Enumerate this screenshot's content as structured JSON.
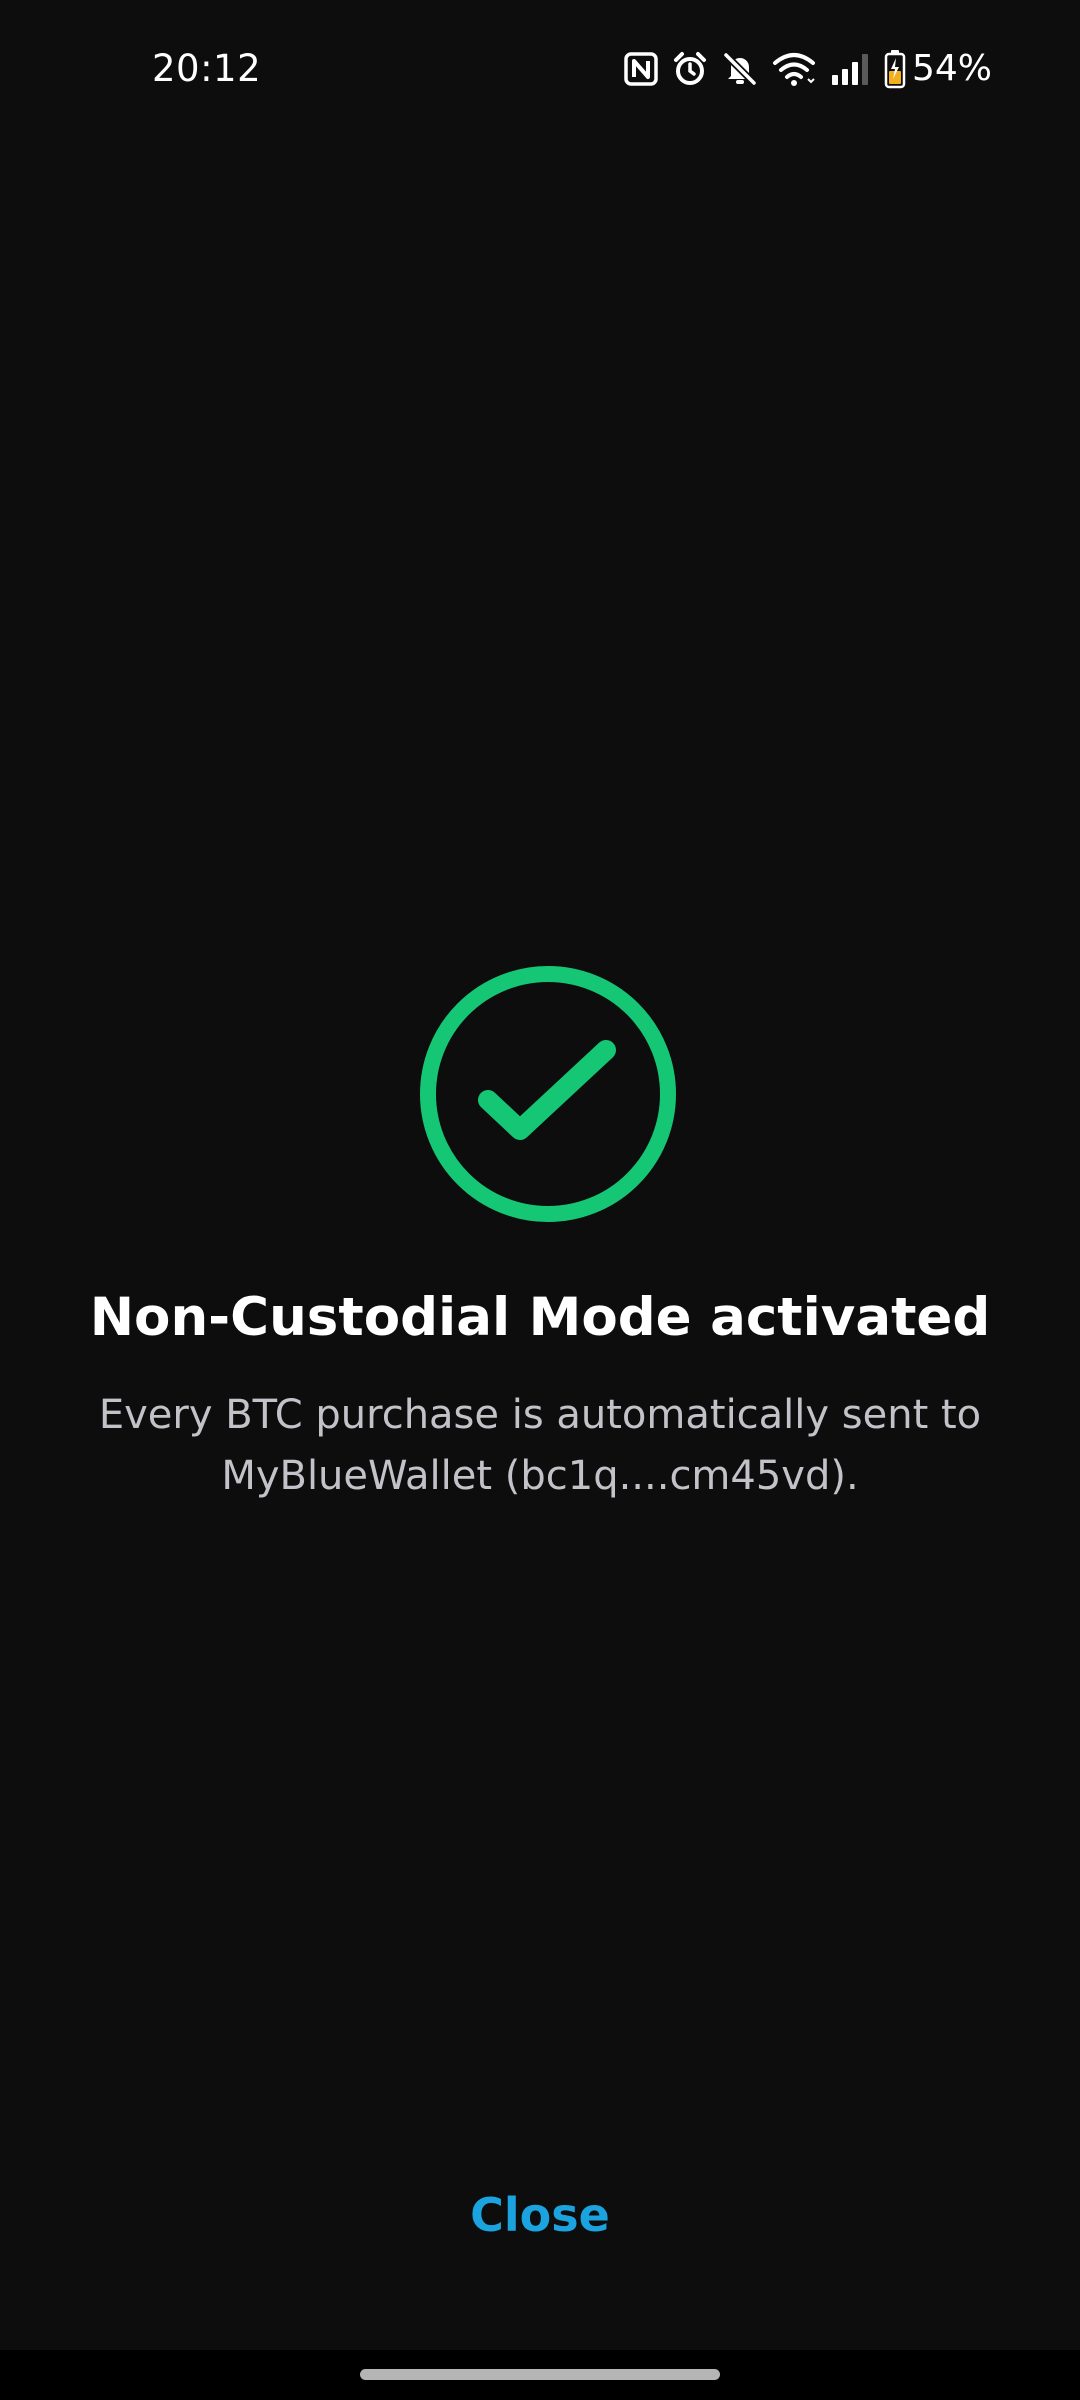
{
  "status_bar": {
    "time": "20:12",
    "battery_percent": "54%",
    "icons": [
      "nfc-icon",
      "alarm-icon",
      "bell-muted-icon",
      "wifi-icon",
      "signal-icon",
      "battery-charging-icon"
    ],
    "signal_level": 0.75,
    "battery_level": 0.54
  },
  "success": {
    "icon": "check-circle-icon",
    "color": "#15c774"
  },
  "title": "Non-Custodial Mode activated",
  "description": {
    "line1": "Every BTC purchase is automatically sent to",
    "line2": "MyBlueWallet (bc1q....cm45vd)."
  },
  "close_button": {
    "label": "Close",
    "color": "#1aa3df"
  },
  "colors": {
    "background": "#0d0d0d",
    "title_text": "#ffffff",
    "description_text": "#c2c2c8"
  }
}
